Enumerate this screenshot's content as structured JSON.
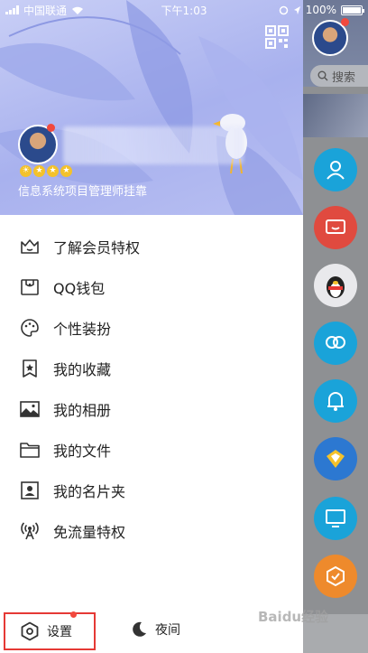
{
  "status_bar": {
    "carrier": "中国联通",
    "time": "下午1:03",
    "battery": "100%"
  },
  "header": {
    "signature": "信息系统项目管理师挂靠",
    "level_icons": [
      "sun-icon",
      "star-icon",
      "star-icon",
      "star-icon"
    ]
  },
  "menu": {
    "items": [
      {
        "icon": "vip-crown-icon",
        "label": "了解会员特权"
      },
      {
        "icon": "wallet-icon",
        "label": "QQ钱包"
      },
      {
        "icon": "palette-icon",
        "label": "个性装扮"
      },
      {
        "icon": "favorite-bookmark-icon",
        "label": "我的收藏"
      },
      {
        "icon": "photo-album-icon",
        "label": "我的相册"
      },
      {
        "icon": "folder-icon",
        "label": "我的文件"
      },
      {
        "icon": "business-card-icon",
        "label": "我的名片夹"
      },
      {
        "icon": "free-data-icon",
        "label": "免流量特权"
      }
    ]
  },
  "bottom": {
    "settings_label": "设置",
    "night_label": "夜间"
  },
  "underlay": {
    "search_label": "搜索",
    "circle_colors": [
      "#1aa3d9",
      "#e04a3f",
      "#e9e9ec",
      "#1aa3d9",
      "#1aa3d9",
      "#2c78d1",
      "#1aa3d9",
      "#ee8a2c"
    ]
  },
  "watermark": "Baidu经验"
}
